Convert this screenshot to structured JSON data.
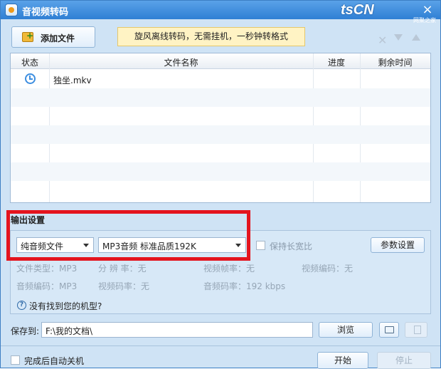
{
  "window": {
    "title": "音视频转码",
    "brand": "tsCN",
    "brand_sub": "网聚之家",
    "close_glyph": "×"
  },
  "toolbar": {
    "add_file": "添加文件",
    "promo": "旋风离线转码，无需挂机，一秒钟转格式",
    "delete_glyph": "✕"
  },
  "list": {
    "columns": [
      "状态",
      "文件名称",
      "进度",
      "剩余时间"
    ],
    "rows": [
      {
        "status_icon": "clock-icon",
        "name": "独坐.mkv",
        "progress": "",
        "remaining": ""
      }
    ]
  },
  "output": {
    "title": "输出设置",
    "format_type": "纯音频文件",
    "preset": "MP3音频 标准品质192K",
    "keep_ratio": "保持长宽比",
    "param_button": "参数设置",
    "info": {
      "file_type": "文件类型：MP3",
      "resolution": "分 辨 率：无",
      "video_fps": "视频帧率：无",
      "video_codec": "视频编码：无",
      "audio_codec": "音频编码：MP3",
      "video_bitrate": "视频码率：无",
      "audio_bitrate": "音频码率：192 kbps"
    },
    "help_text": "没有找到您的机型?"
  },
  "save": {
    "label": "保存到:",
    "path": "F:\\我的文档\\",
    "browse": "浏览"
  },
  "footer": {
    "shutdown": "完成后自动关机",
    "start": "开始",
    "stop": "停止"
  },
  "colors": {
    "titlebar": "#3b8ae0",
    "highlight_box": "#e4141e",
    "promo_bg": "#fff3c4",
    "panel_bg": "#cfe3f5"
  }
}
